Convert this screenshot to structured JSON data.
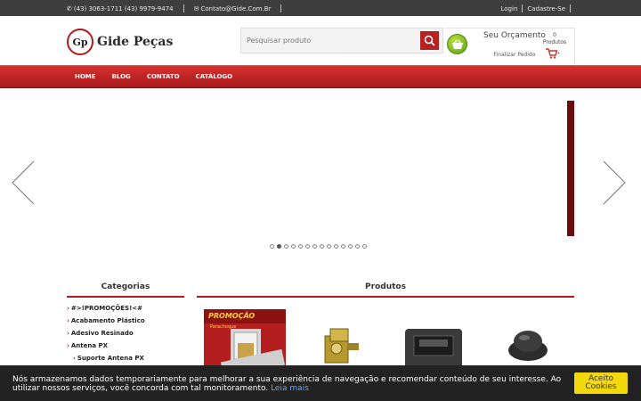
{
  "topbar": {
    "phone": "(43) 3063-1711 (43) 9979-9474",
    "email": "Contato@Gide.Com.Br",
    "login": "Login",
    "signup": "Cadastre-Se"
  },
  "header": {
    "logo_mark": "Gp",
    "logo_text": "Gide Peças",
    "search_placeholder": "Pesquisar produto",
    "quote_title": "Seu Orçamento",
    "quote_finalize": "Finalizar Pedido",
    "cart_count": "0",
    "cart_label": "Produtos"
  },
  "nav": {
    "items": [
      "HOME",
      "BLOG",
      "CONTATO",
      "CATÁLOGO"
    ]
  },
  "slider": {
    "dots_total": 14,
    "active_index": 1
  },
  "sidebar": {
    "title": "Categorias",
    "items": [
      {
        "label": "#>!PROMOÇÕES!<#",
        "sub": false
      },
      {
        "label": "Acabamento Plástico",
        "sub": false
      },
      {
        "label": "Adesivo Resinado",
        "sub": false
      },
      {
        "label": "Antena PX",
        "sub": false
      },
      {
        "label": "Suporte Antena PX",
        "sub": true
      }
    ]
  },
  "products": {
    "title": "Produtos",
    "promo_banner": "PROMOÇÃO",
    "promo_sub": "Parachoque"
  },
  "cookie": {
    "message": "Nós armazenamos dados temporariamente para melhorar a sua experiência de navegação e recomendar conteúdo de seu interesse. Ao utilizar nossos serviços, você concorda com tal monitoramento.",
    "link": "Leia mais",
    "accept_line1": "Aceito",
    "accept_line2": "Cookies"
  },
  "colors": {
    "topbar": "#3e3e3e",
    "nav_red": "#c02424",
    "accent_red": "#b01b1b",
    "cookie_bg": "#222222",
    "accept_yellow": "#f3d90b"
  }
}
